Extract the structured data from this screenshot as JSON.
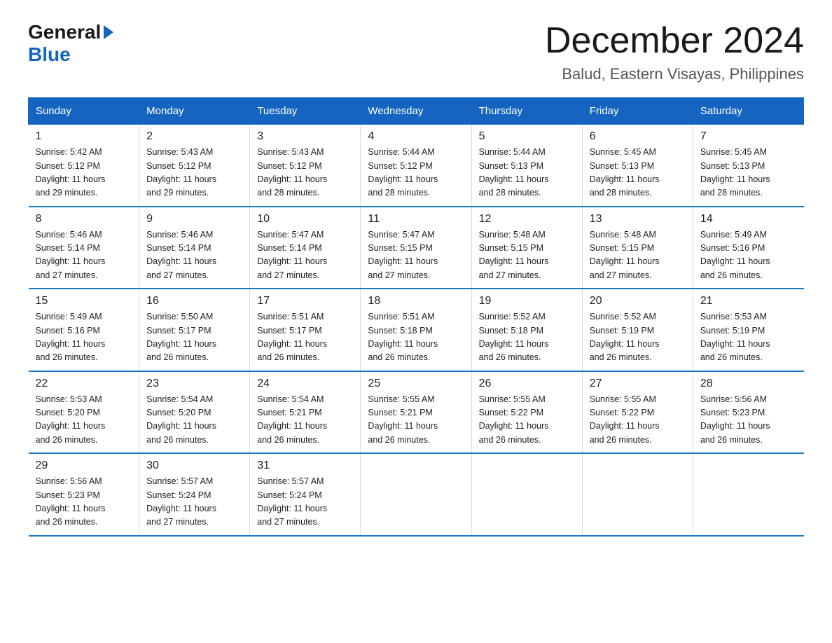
{
  "logo": {
    "general": "General",
    "blue": "Blue"
  },
  "header": {
    "title": "December 2024",
    "subtitle": "Balud, Eastern Visayas, Philippines"
  },
  "weekdays": [
    "Sunday",
    "Monday",
    "Tuesday",
    "Wednesday",
    "Thursday",
    "Friday",
    "Saturday"
  ],
  "weeks": [
    [
      {
        "day": "1",
        "sunrise": "5:42 AM",
        "sunset": "5:12 PM",
        "daylight": "11 hours and 29 minutes."
      },
      {
        "day": "2",
        "sunrise": "5:43 AM",
        "sunset": "5:12 PM",
        "daylight": "11 hours and 29 minutes."
      },
      {
        "day": "3",
        "sunrise": "5:43 AM",
        "sunset": "5:12 PM",
        "daylight": "11 hours and 28 minutes."
      },
      {
        "day": "4",
        "sunrise": "5:44 AM",
        "sunset": "5:12 PM",
        "daylight": "11 hours and 28 minutes."
      },
      {
        "day": "5",
        "sunrise": "5:44 AM",
        "sunset": "5:13 PM",
        "daylight": "11 hours and 28 minutes."
      },
      {
        "day": "6",
        "sunrise": "5:45 AM",
        "sunset": "5:13 PM",
        "daylight": "11 hours and 28 minutes."
      },
      {
        "day": "7",
        "sunrise": "5:45 AM",
        "sunset": "5:13 PM",
        "daylight": "11 hours and 28 minutes."
      }
    ],
    [
      {
        "day": "8",
        "sunrise": "5:46 AM",
        "sunset": "5:14 PM",
        "daylight": "11 hours and 27 minutes."
      },
      {
        "day": "9",
        "sunrise": "5:46 AM",
        "sunset": "5:14 PM",
        "daylight": "11 hours and 27 minutes."
      },
      {
        "day": "10",
        "sunrise": "5:47 AM",
        "sunset": "5:14 PM",
        "daylight": "11 hours and 27 minutes."
      },
      {
        "day": "11",
        "sunrise": "5:47 AM",
        "sunset": "5:15 PM",
        "daylight": "11 hours and 27 minutes."
      },
      {
        "day": "12",
        "sunrise": "5:48 AM",
        "sunset": "5:15 PM",
        "daylight": "11 hours and 27 minutes."
      },
      {
        "day": "13",
        "sunrise": "5:48 AM",
        "sunset": "5:15 PM",
        "daylight": "11 hours and 27 minutes."
      },
      {
        "day": "14",
        "sunrise": "5:49 AM",
        "sunset": "5:16 PM",
        "daylight": "11 hours and 26 minutes."
      }
    ],
    [
      {
        "day": "15",
        "sunrise": "5:49 AM",
        "sunset": "5:16 PM",
        "daylight": "11 hours and 26 minutes."
      },
      {
        "day": "16",
        "sunrise": "5:50 AM",
        "sunset": "5:17 PM",
        "daylight": "11 hours and 26 minutes."
      },
      {
        "day": "17",
        "sunrise": "5:51 AM",
        "sunset": "5:17 PM",
        "daylight": "11 hours and 26 minutes."
      },
      {
        "day": "18",
        "sunrise": "5:51 AM",
        "sunset": "5:18 PM",
        "daylight": "11 hours and 26 minutes."
      },
      {
        "day": "19",
        "sunrise": "5:52 AM",
        "sunset": "5:18 PM",
        "daylight": "11 hours and 26 minutes."
      },
      {
        "day": "20",
        "sunrise": "5:52 AM",
        "sunset": "5:19 PM",
        "daylight": "11 hours and 26 minutes."
      },
      {
        "day": "21",
        "sunrise": "5:53 AM",
        "sunset": "5:19 PM",
        "daylight": "11 hours and 26 minutes."
      }
    ],
    [
      {
        "day": "22",
        "sunrise": "5:53 AM",
        "sunset": "5:20 PM",
        "daylight": "11 hours and 26 minutes."
      },
      {
        "day": "23",
        "sunrise": "5:54 AM",
        "sunset": "5:20 PM",
        "daylight": "11 hours and 26 minutes."
      },
      {
        "day": "24",
        "sunrise": "5:54 AM",
        "sunset": "5:21 PM",
        "daylight": "11 hours and 26 minutes."
      },
      {
        "day": "25",
        "sunrise": "5:55 AM",
        "sunset": "5:21 PM",
        "daylight": "11 hours and 26 minutes."
      },
      {
        "day": "26",
        "sunrise": "5:55 AM",
        "sunset": "5:22 PM",
        "daylight": "11 hours and 26 minutes."
      },
      {
        "day": "27",
        "sunrise": "5:55 AM",
        "sunset": "5:22 PM",
        "daylight": "11 hours and 26 minutes."
      },
      {
        "day": "28",
        "sunrise": "5:56 AM",
        "sunset": "5:23 PM",
        "daylight": "11 hours and 26 minutes."
      }
    ],
    [
      {
        "day": "29",
        "sunrise": "5:56 AM",
        "sunset": "5:23 PM",
        "daylight": "11 hours and 26 minutes."
      },
      {
        "day": "30",
        "sunrise": "5:57 AM",
        "sunset": "5:24 PM",
        "daylight": "11 hours and 27 minutes."
      },
      {
        "day": "31",
        "sunrise": "5:57 AM",
        "sunset": "5:24 PM",
        "daylight": "11 hours and 27 minutes."
      },
      {
        "day": "",
        "sunrise": "",
        "sunset": "",
        "daylight": ""
      },
      {
        "day": "",
        "sunrise": "",
        "sunset": "",
        "daylight": ""
      },
      {
        "day": "",
        "sunrise": "",
        "sunset": "",
        "daylight": ""
      },
      {
        "day": "",
        "sunrise": "",
        "sunset": "",
        "daylight": ""
      }
    ]
  ],
  "labels": {
    "sunrise": "Sunrise:",
    "sunset": "Sunset:",
    "daylight": "Daylight:"
  }
}
